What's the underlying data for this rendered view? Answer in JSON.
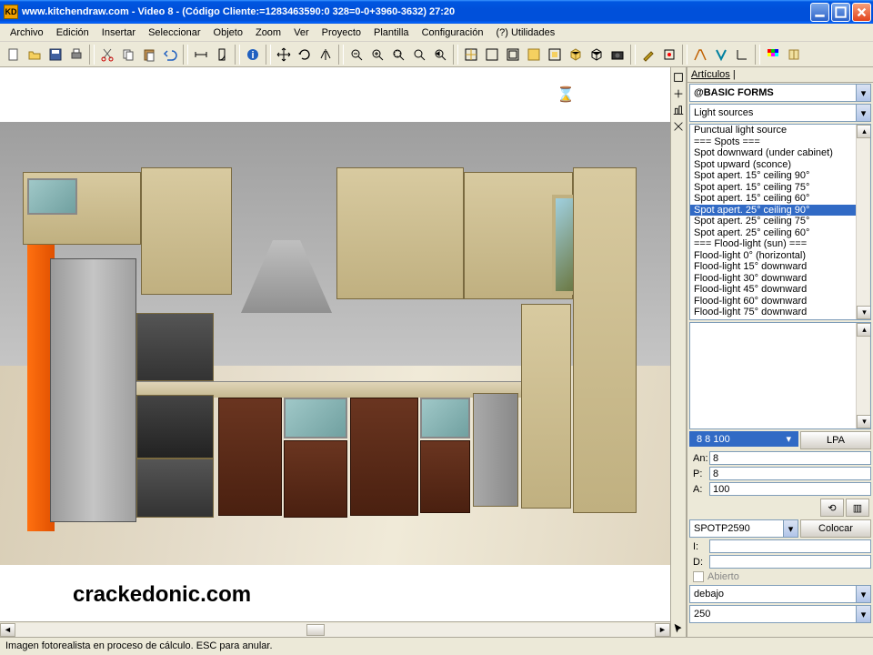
{
  "title": "www.kitchendraw.com - Video 8 - (Código Cliente:=1283463590:0 328=0-0+3960-3632) 27:20",
  "logo": "KD",
  "menu": [
    "Archivo",
    "Edición",
    "Insertar",
    "Seleccionar",
    "Objeto",
    "Zoom",
    "Ver",
    "Proyecto",
    "Plantilla",
    "Configuración",
    "(?) Utilidades"
  ],
  "panel": {
    "title": "Artículos",
    "catalog": "@BASIC FORMS",
    "category": "Light sources",
    "items": [
      "Punctual light source",
      "=== Spots ===",
      "Spot downward (under cabinet)",
      "Spot upward (sconce)",
      "Spot apert. 15° ceiling 90°",
      "Spot apert. 15° ceiling 75°",
      "Spot apert. 15° ceiling 60°",
      "Spot apert. 25° ceiling 90°",
      "Spot apert. 25° ceiling 75°",
      "Spot apert. 25° ceiling 60°",
      "=== Flood-light (sun) ===",
      "Flood-light 0° (horizontal)",
      "Flood-light 15° downward",
      "Flood-light 30° downward",
      "Flood-light 45° downward",
      "Flood-light 60° downward",
      "Flood-light 75° downward"
    ],
    "selected_index": 7,
    "dims_header": "8   8 100",
    "lpa": "LPA",
    "an_label": "An:",
    "an": "8",
    "p_label": "P:",
    "p": "8",
    "a_label": "A:",
    "a": "100",
    "code": "SPOTP2590",
    "place": "Colocar",
    "i_label": "I:",
    "d_label": "D:",
    "abierto": "Abierto",
    "pos_sel": "debajo",
    "alt_sel": "250"
  },
  "watermark": "crackedonic.com",
  "status": "Imagen fotorealista en proceso de cálculo. ESC para anular."
}
